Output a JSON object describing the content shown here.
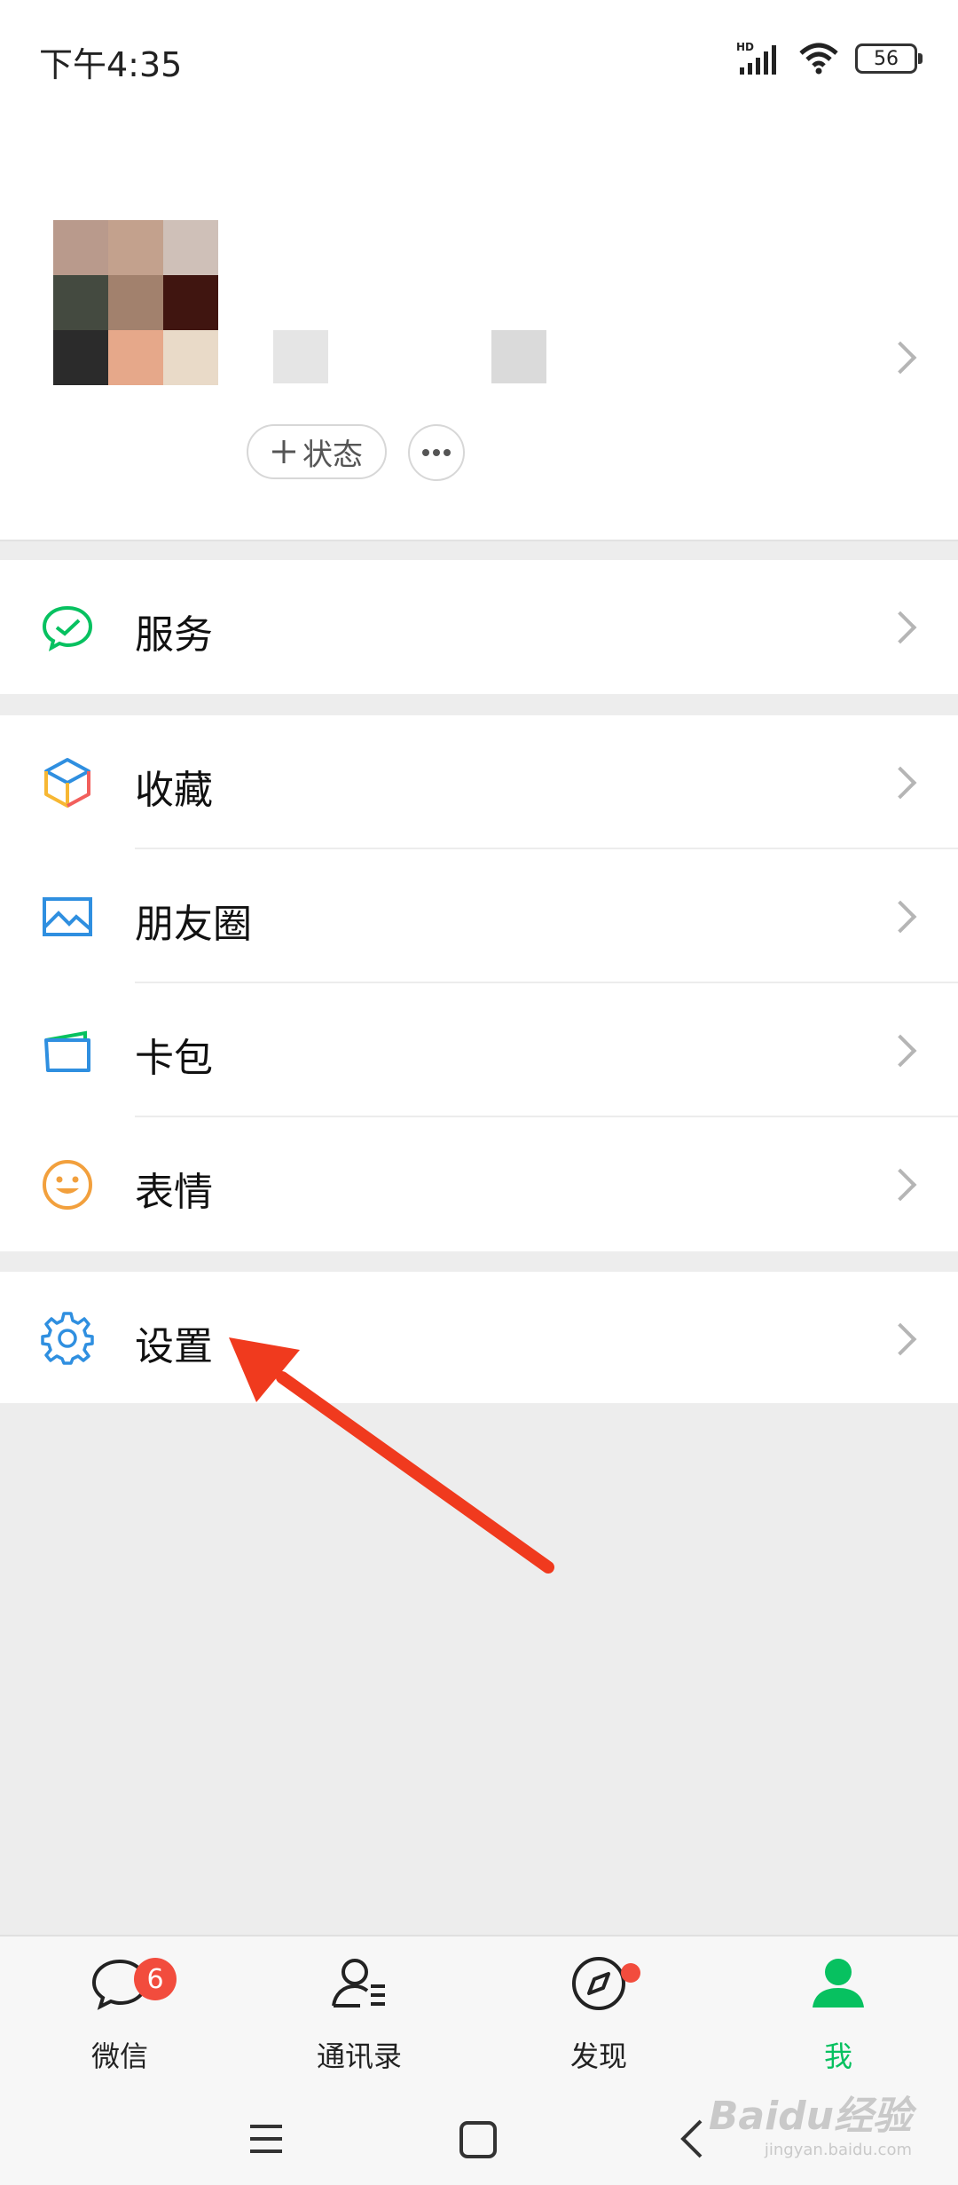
{
  "status_bar": {
    "time": "下午4:35",
    "network": "HD",
    "battery": "56"
  },
  "profile": {
    "status_button_label": "状态",
    "status_button_icon": "plus-icon",
    "more_icon": "more-dots-icon"
  },
  "menu": {
    "service": {
      "label": "服务",
      "icon": "wechat-pay-icon"
    },
    "favorites": {
      "label": "收藏",
      "icon": "cube-icon"
    },
    "moments": {
      "label": "朋友圈",
      "icon": "image-icon"
    },
    "cards": {
      "label": "卡包",
      "icon": "card-icon"
    },
    "stickers": {
      "label": "表情",
      "icon": "smiley-icon"
    },
    "settings": {
      "label": "设置",
      "icon": "gear-icon"
    }
  },
  "tabs": [
    {
      "label": "微信",
      "icon": "chat-icon",
      "badge": "6"
    },
    {
      "label": "通讯录",
      "icon": "contacts-icon"
    },
    {
      "label": "发现",
      "icon": "compass-icon",
      "dot": true
    },
    {
      "label": "我",
      "icon": "person-icon",
      "active": true
    }
  ],
  "watermark": {
    "text": "Baidu经验",
    "sub": "jingyan.baidu.com"
  },
  "colors": {
    "accent_green": "#07c160",
    "badge_red": "#f24c3d",
    "annotation_arrow": "#f03a1e"
  }
}
